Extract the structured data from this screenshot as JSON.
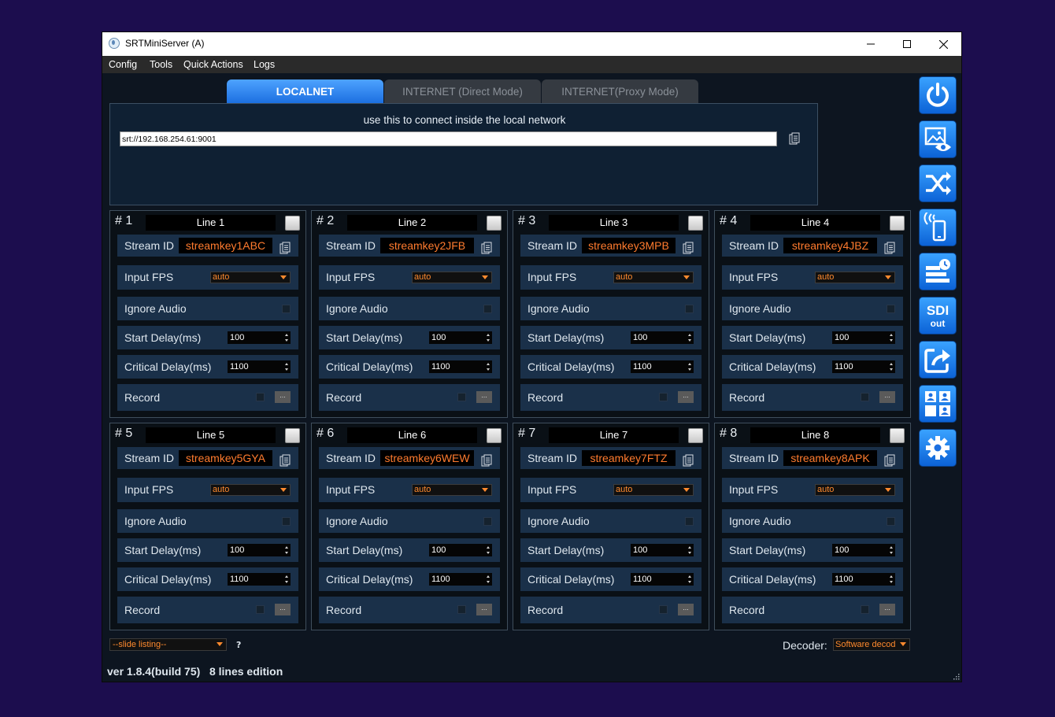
{
  "window": {
    "title": "SRTMiniServer (A)",
    "controls": [
      "minimize",
      "maximize",
      "close"
    ]
  },
  "menu": [
    "Config",
    "Tools",
    "Quick Actions",
    "Logs"
  ],
  "tabs": [
    {
      "label": "LOCALNET",
      "active": true
    },
    {
      "label": "INTERNET (Direct Mode)",
      "active": false
    },
    {
      "label": "INTERNET(Proxy Mode)",
      "active": false
    }
  ],
  "connection": {
    "hint": "use this to connect inside the local network",
    "url": "srt://192.168.254.61:9001"
  },
  "labels": {
    "stream_id": "Stream ID",
    "input_fps": "Input FPS",
    "ignore_audio": "Ignore Audio",
    "start_delay": "Start Delay(ms)",
    "critical_delay": "Critical Delay(ms)",
    "record": "Record",
    "record_browse": "..."
  },
  "lines": [
    {
      "number": "# 1",
      "name": "Line 1",
      "stream_id": "streamkey1ABC",
      "fps": "auto",
      "start_delay": "100",
      "critical_delay": "1100"
    },
    {
      "number": "# 2",
      "name": "Line 2",
      "stream_id": "streamkey2JFB",
      "fps": "auto",
      "start_delay": "100",
      "critical_delay": "1100"
    },
    {
      "number": "# 3",
      "name": "Line 3",
      "stream_id": "streamkey3MPB",
      "fps": "auto",
      "start_delay": "100",
      "critical_delay": "1100"
    },
    {
      "number": "# 4",
      "name": "Line 4",
      "stream_id": "streamkey4JBZ",
      "fps": "auto",
      "start_delay": "100",
      "critical_delay": "1100"
    },
    {
      "number": "# 5",
      "name": "Line 5",
      "stream_id": "streamkey5GYA",
      "fps": "auto",
      "start_delay": "100",
      "critical_delay": "1100"
    },
    {
      "number": "# 6",
      "name": "Line 6",
      "stream_id": "streamkey6WEW",
      "fps": "auto",
      "start_delay": "100",
      "critical_delay": "1100"
    },
    {
      "number": "# 7",
      "name": "Line 7",
      "stream_id": "streamkey7FTZ",
      "fps": "auto",
      "start_delay": "100",
      "critical_delay": "1100"
    },
    {
      "number": "# 8",
      "name": "Line 8",
      "stream_id": "streamkey8APK",
      "fps": "auto",
      "start_delay": "100",
      "critical_delay": "1100"
    }
  ],
  "sidebar_buttons": [
    {
      "icon": "power-icon"
    },
    {
      "icon": "image-preview-icon"
    },
    {
      "icon": "shuffle-icon"
    },
    {
      "icon": "mobile-broadcast-icon"
    },
    {
      "icon": "schedule-icon"
    },
    {
      "icon": "sdi-out-icon",
      "text_top": "SDI",
      "text_bottom": "out"
    },
    {
      "icon": "share-icon"
    },
    {
      "icon": "users-grid-icon"
    },
    {
      "icon": "gear-icon"
    }
  ],
  "footer": {
    "slide_listing": "--slide listing--",
    "help": "?",
    "decoder_label": "Decoder:",
    "decoder_value": "Software decod",
    "version": "ver 1.8.4(build 75)   8 lines edition"
  },
  "colors": {
    "accent": "#1c6fe0",
    "stream_id_text": "#ff7b2e",
    "row_background": "#1a3049",
    "desktop": "#1c0d4e"
  }
}
